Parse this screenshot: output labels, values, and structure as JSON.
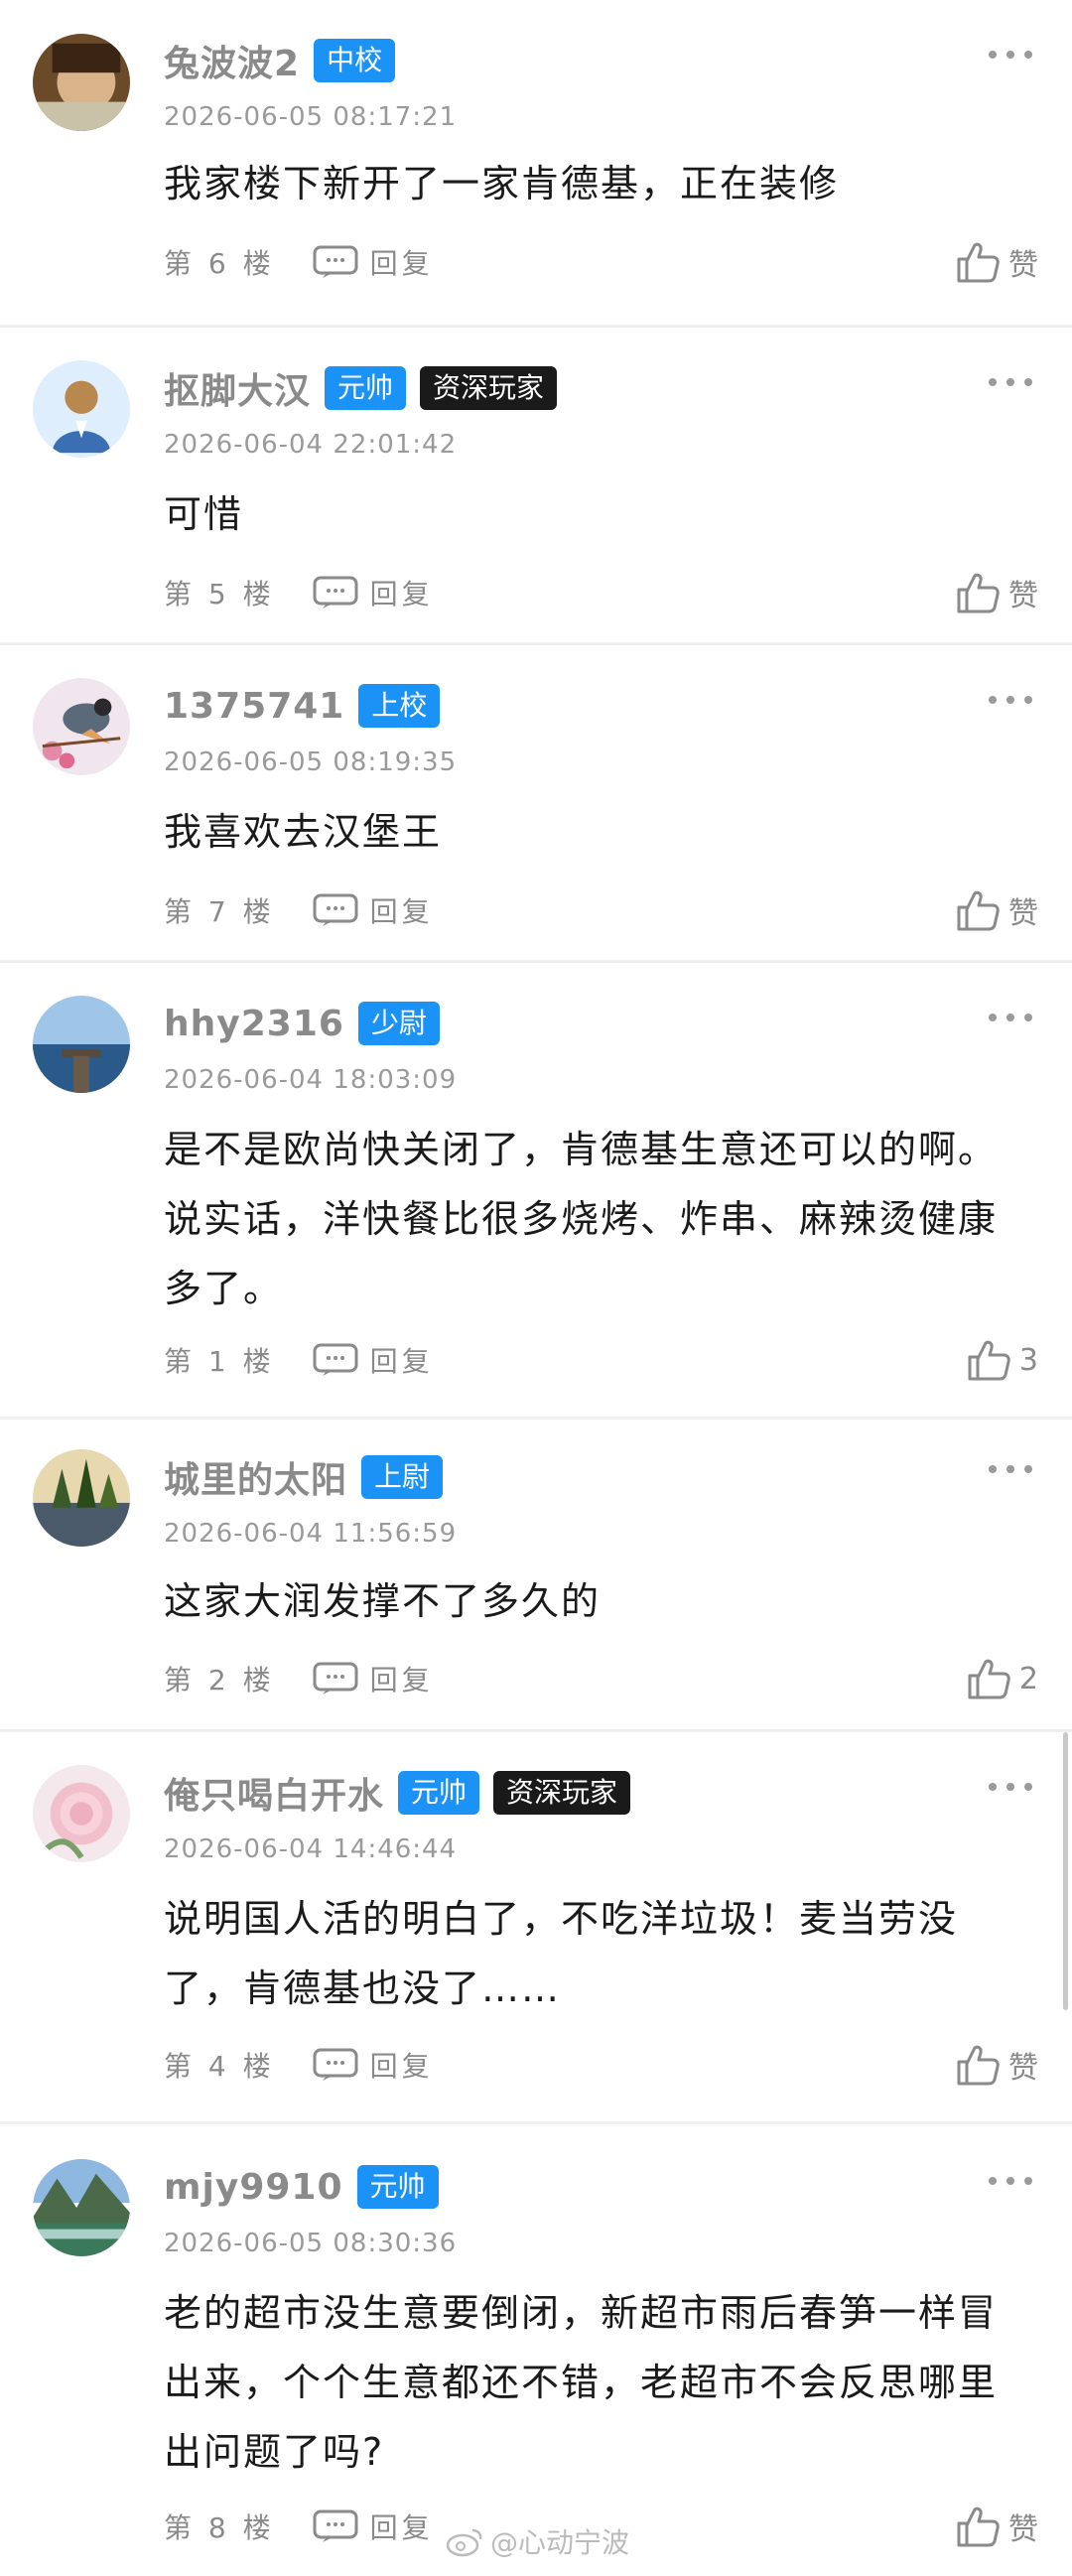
{
  "comments": [
    {
      "username": "兔波波2",
      "badges": [
        {
          "text": "中校",
          "style": "blue"
        }
      ],
      "time": "2026-06-05 08:17:21",
      "text": "我家楼下新开了一家肯德基，正在装修",
      "floor": "第 6 楼",
      "reply": "回复",
      "likes": "赞",
      "avatar": "portrait"
    },
    {
      "username": "抠脚大汉",
      "badges": [
        {
          "text": "元帅",
          "style": "blue"
        },
        {
          "text": "资深玩家",
          "style": "black"
        }
      ],
      "time": "2026-06-04 22:01:42",
      "text": "可惜",
      "floor": "第 5 楼",
      "reply": "回复",
      "likes": "赞",
      "avatar": "default-person"
    },
    {
      "username": "1375741",
      "badges": [
        {
          "text": "上校",
          "style": "blue"
        }
      ],
      "time": "2026-06-05 08:19:35",
      "text": "我喜欢去汉堡王",
      "floor": "第 7 楼",
      "reply": "回复",
      "likes": "赞",
      "avatar": "bird"
    },
    {
      "username": "hhy2316",
      "badges": [
        {
          "text": "少尉",
          "style": "blue"
        }
      ],
      "time": "2026-06-04 18:03:09",
      "text": "是不是欧尚快关闭了，肯德基生意还可以的啊。说实话，洋快餐比很多烧烤、炸串、麻辣烫健康多了。",
      "floor": "第 1 楼",
      "reply": "回复",
      "likes": "3",
      "avatar": "lake-pier"
    },
    {
      "username": "城里的太阳",
      "badges": [
        {
          "text": "上尉",
          "style": "blue"
        }
      ],
      "time": "2026-06-04 11:56:59",
      "text": "这家大润发撑不了多久的",
      "floor": "第 2 楼",
      "reply": "回复",
      "likes": "2",
      "avatar": "trees-lake"
    },
    {
      "username": "俺只喝白开水",
      "badges": [
        {
          "text": "元帅",
          "style": "blue"
        },
        {
          "text": "资深玩家",
          "style": "black"
        }
      ],
      "time": "2026-06-04 14:46:44",
      "text": "说明国人活的明白了，不吃洋垃圾！麦当劳没了，肯德基也没了……",
      "floor": "第 4 楼",
      "reply": "回复",
      "likes": "赞",
      "avatar": "flower"
    },
    {
      "username": "mjy9910",
      "badges": [
        {
          "text": "元帅",
          "style": "blue"
        }
      ],
      "time": "2026-06-05 08:30:36",
      "text": "老的超市没生意要倒闭，新超市雨后春笋一样冒出来，个个生意都还不错，老超市不会反思哪里出问题了吗?",
      "floor": "第 8 楼",
      "reply": "回复",
      "likes": "赞",
      "avatar": "mountain-lake"
    }
  ],
  "watermark": "@心动宁波",
  "colors": {
    "badge_blue": "#1b92f5",
    "badge_black": "#1a1a1a",
    "meta_gray": "#8a8a8a"
  }
}
